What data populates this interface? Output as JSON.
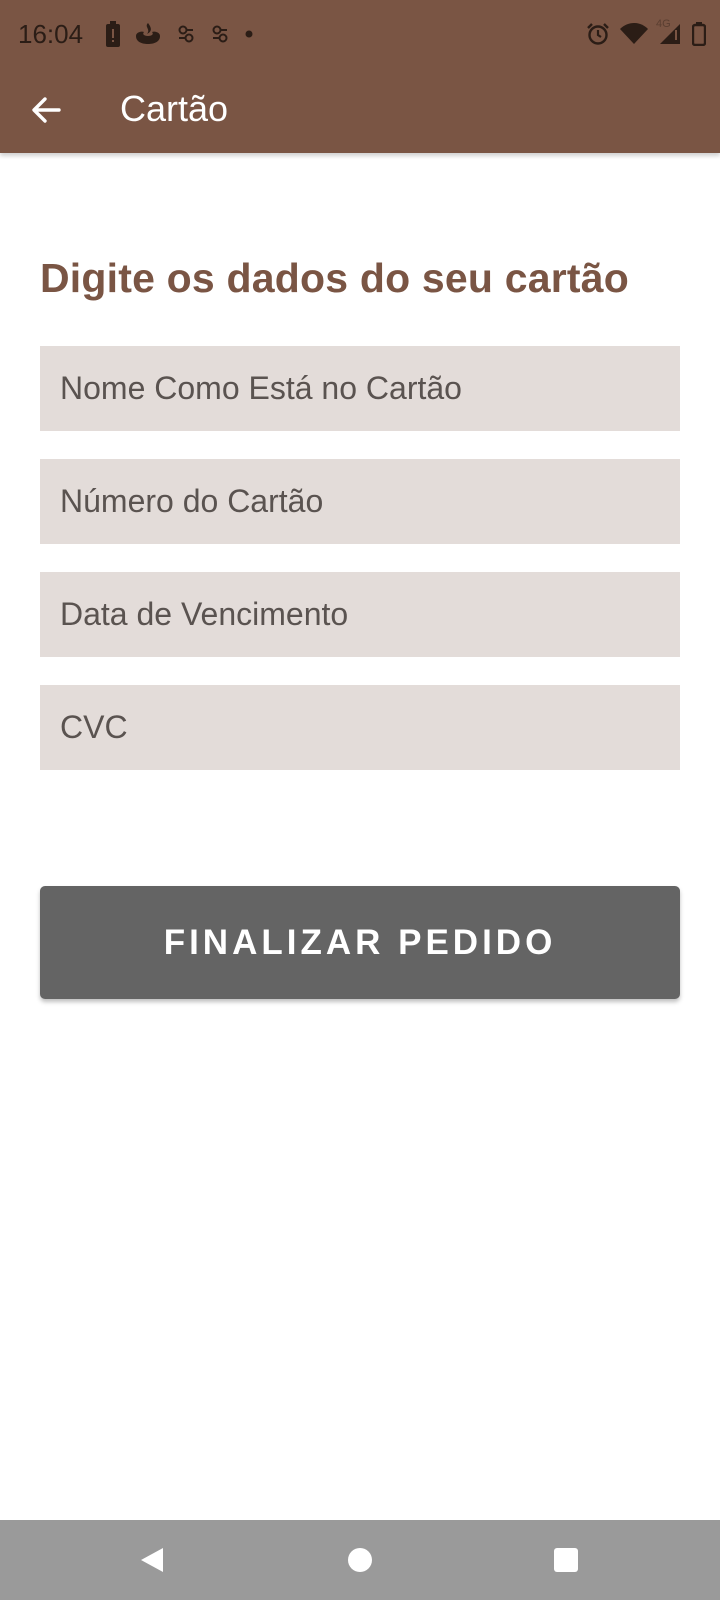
{
  "status_bar": {
    "time": "16:04",
    "network_label": "4G",
    "left_icons": [
      "battery-alert-icon",
      "santander-icon",
      "app-notification-icon",
      "app-notification-icon",
      "more-dot-icon"
    ],
    "right_icons": [
      "alarm-icon",
      "wifi-icon",
      "signal-icon",
      "battery-icon"
    ]
  },
  "app_bar": {
    "title": "Cartão",
    "back_icon": "arrow-back-icon",
    "background": "#7a5544"
  },
  "form": {
    "heading": "Digite os dados do seu cartão",
    "fields": [
      {
        "placeholder": "Nome Como Está no Cartão",
        "value": ""
      },
      {
        "placeholder": "Número do Cartão",
        "value": ""
      },
      {
        "placeholder": "Data de Vencimento",
        "value": ""
      },
      {
        "placeholder": "CVC",
        "value": ""
      }
    ],
    "submit_label": "FINALIZAR PEDIDO"
  },
  "colors": {
    "accent": "#7a5544",
    "field_background": "#e3dcd9",
    "button_background": "#646464"
  },
  "nav_bar": {
    "buttons": [
      "back-triangle-icon",
      "home-circle-icon",
      "recents-square-icon"
    ]
  }
}
